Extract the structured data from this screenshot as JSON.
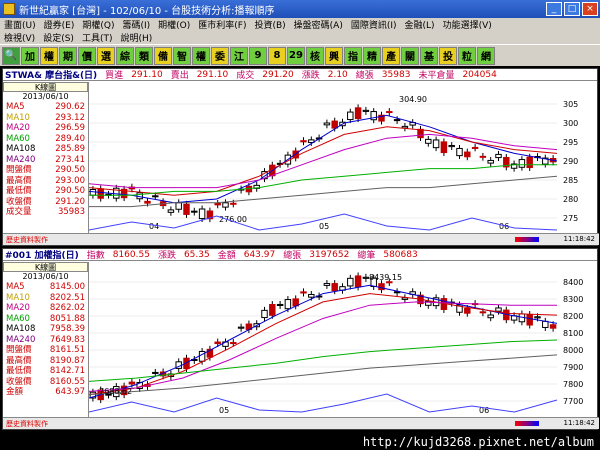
{
  "title": "新世紀贏家 [台灣] - 102/06/10 - 台股技術分析:播報順序",
  "menu": {
    "row1": [
      "畫面(U)",
      "證券(E)",
      "期權(Q)",
      "籌碼(I)",
      "期權(O)",
      "匯市利率(F)",
      "投資(B)",
      "操盤密碼(A)",
      "國際資訊(I)",
      "金融(L)",
      "功能選擇(V)"
    ],
    "row2": [
      "檢視(V)",
      "設定(S)",
      "工具(T)",
      "說明(H)"
    ]
  },
  "toolbar": [
    "加",
    "權",
    "期",
    "價",
    "選",
    "綜",
    "類",
    "備",
    "智",
    "權",
    "委",
    "江",
    "9",
    "8",
    "29",
    "核",
    "興",
    "指",
    "精",
    "產",
    "關",
    "基",
    "投",
    "粒",
    "網"
  ],
  "panel1": {
    "symbol": "STWA& 摩台指&(日)",
    "fields": [
      {
        "label": "買進",
        "value": "291.10"
      },
      {
        "label": "賣出",
        "value": "291.10"
      },
      {
        "label": "成交",
        "value": "291.20"
      },
      {
        "label": "漲跌",
        "value": "2.10"
      },
      {
        "label": "總張",
        "value": "35983"
      },
      {
        "label": "未平倉量",
        "value": "204054"
      }
    ],
    "side_head": "K線圖",
    "side_date": "2013/06/10",
    "side_rows": [
      {
        "label": "MA5",
        "value": "290.62"
      },
      {
        "label": "MA10",
        "value": "293.12"
      },
      {
        "label": "MA20",
        "value": "296.59"
      },
      {
        "label": "MA60",
        "value": "289.40"
      },
      {
        "label": "MA108",
        "value": "285.89"
      },
      {
        "label": "MA240",
        "value": "273.41"
      },
      {
        "label": "開盤價",
        "value": "290.50"
      },
      {
        "label": "最高價",
        "value": "293.00"
      },
      {
        "label": "最低價",
        "value": "290.50"
      },
      {
        "label": "收盤價",
        "value": "291.20"
      },
      {
        "label": "成交量",
        "value": "35983"
      }
    ],
    "axis": [
      "305",
      "300",
      "295",
      "290",
      "285",
      "280",
      "275"
    ],
    "months": [
      "04",
      "05",
      "06"
    ],
    "annotations": {
      "high": "304.90",
      "low": "276.00"
    },
    "strip": "歷史資料製作",
    "strip_time": "11:18:42"
  },
  "panel2": {
    "symbol": "#001 加權指(日)",
    "fields": [
      {
        "label": "指數",
        "value": "8160.55"
      },
      {
        "label": "漲跌",
        "value": "65.35"
      },
      {
        "label": "金額",
        "value": "643.97"
      },
      {
        "label": "總張",
        "value": "3197652"
      },
      {
        "label": "總筆",
        "value": "580683"
      }
    ],
    "side_head": "K線圖",
    "side_date": "2013/06/10",
    "side_rows": [
      {
        "label": "MA5",
        "value": "8145.00"
      },
      {
        "label": "MA10",
        "value": "8202.51"
      },
      {
        "label": "MA20",
        "value": "8262.02"
      },
      {
        "label": "MA60",
        "value": "8051.88"
      },
      {
        "label": "MA108",
        "value": "7958.39"
      },
      {
        "label": "MA240",
        "value": "7649.83"
      },
      {
        "label": "開盤價",
        "value": "8161.51"
      },
      {
        "label": "最高價",
        "value": "8190.87"
      },
      {
        "label": "最低價",
        "value": "8142.71"
      },
      {
        "label": "收盤價",
        "value": "8160.55"
      },
      {
        "label": "金額",
        "value": "643.97"
      }
    ],
    "axis": [
      "8400",
      "8300",
      "8200",
      "8100",
      "8000",
      "7900",
      "7800",
      "7700"
    ],
    "months": [
      "05",
      "06"
    ],
    "annotations": {
      "high": "8439.15",
      "low": "7688.62"
    },
    "strip": "歷史資料製作",
    "strip_time": "11:18:42"
  },
  "watermark": "http://kujd3268.pixnet.net/album"
}
